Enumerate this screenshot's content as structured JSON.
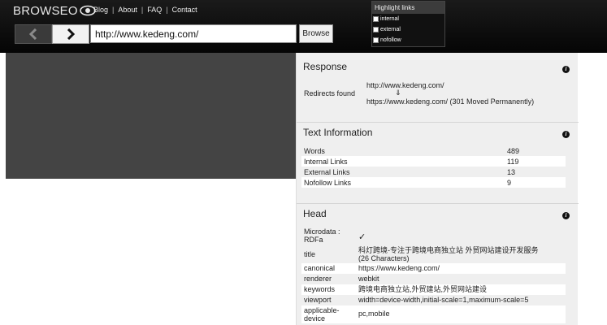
{
  "header": {
    "logo_text": "BROWSEO",
    "nav": [
      "Blog",
      "About",
      "FAQ",
      "Contact"
    ],
    "url_value": "http://www.kedeng.com/",
    "browse_label": "Browse",
    "highlight": {
      "title": "Highlight links",
      "options": [
        "internal",
        "external",
        "nofollow"
      ]
    }
  },
  "response": {
    "title": "Response",
    "label": "Redirects found",
    "from_url": "http://www.kedeng.com/",
    "arrow": "⇓",
    "to_url": "https://www.kedeng.com/ (301 Moved Permanently)"
  },
  "text_info": {
    "title": "Text Information",
    "rows": [
      {
        "label": "Words",
        "value": "489"
      },
      {
        "label": "Internal Links",
        "value": "119"
      },
      {
        "label": "External Links",
        "value": "13"
      },
      {
        "label": "Nofollow Links",
        "value": "9"
      }
    ]
  },
  "head": {
    "title": "Head",
    "rows": [
      {
        "label": "Microdata : RDFa",
        "value": "✓"
      },
      {
        "label": "title",
        "value": "科灯跨境-专注于跨境电商独立站 外贸网站建设开发服务",
        "value2": "(26 Characters)"
      },
      {
        "label": "canonical",
        "value": "https://www.kedeng.com/"
      },
      {
        "label": "renderer",
        "value": "webkit"
      },
      {
        "label": "keywords",
        "value": "跨境电商独立站,外贸建站,外贸网站建设"
      },
      {
        "label": "viewport",
        "value": "width=device-width,initial-scale=1,maximum-scale=5"
      },
      {
        "label": "applicable-device",
        "value": "pc,mobile"
      }
    ]
  }
}
